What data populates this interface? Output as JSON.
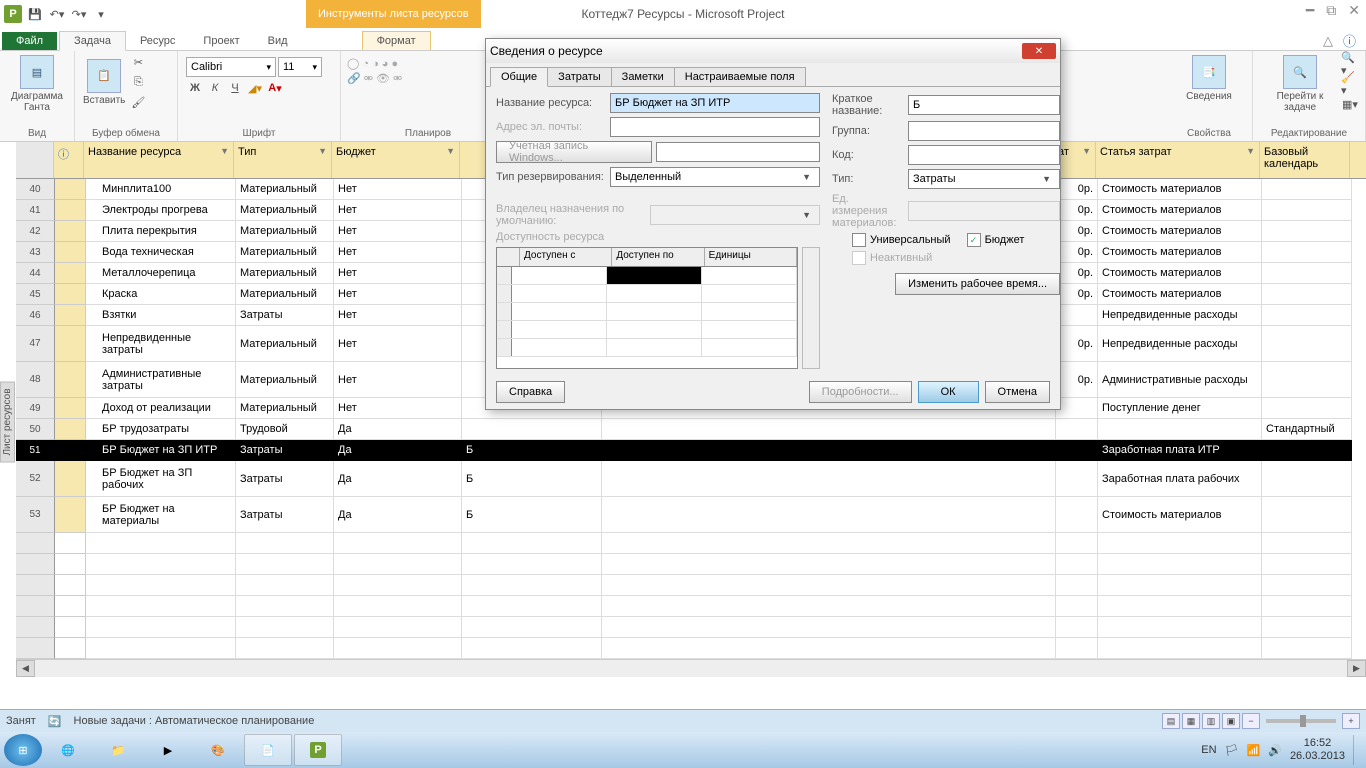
{
  "app": {
    "title": "Коттедж7 Ресурсы - Microsoft Project"
  },
  "contextTab": "Инструменты листа ресурсов",
  "tabs": {
    "file": "Файл",
    "task": "Задача",
    "resource": "Ресурс",
    "project": "Проект",
    "view": "Вид",
    "format": "Формат"
  },
  "ribbon": {
    "gantt": "Диаграмма Ганта",
    "paste": "Вставить",
    "view": "Вид",
    "clipboard": "Буфер обмена",
    "font": "Шрифт",
    "planning": "Планиров",
    "fontName": "Calibri",
    "fontSize": "11",
    "info": "Сведения",
    "gotoTask": "Перейти к задаче",
    "props": "Свойства",
    "edit": "Редактирование"
  },
  "columns": {
    "info": "",
    "name": "Название ресурса",
    "type": "Тип",
    "budget": "Бюджет",
    "costItem": "Статья затрат",
    "baseCal": "Базовый календарь"
  },
  "rows": [
    {
      "n": 40,
      "name": "Минплита100",
      "type": "Материальный",
      "budget": "Нет",
      "cost": "0р.",
      "item": "Стоимость материалов"
    },
    {
      "n": 41,
      "name": "Электроды прогрева",
      "type": "Материальный",
      "budget": "Нет",
      "cost": "0р.",
      "item": "Стоимость материалов"
    },
    {
      "n": 42,
      "name": "Плита перекрытия",
      "type": "Материальный",
      "budget": "Нет",
      "cost": "0р.",
      "item": "Стоимость материалов"
    },
    {
      "n": 43,
      "name": "Вода техническая",
      "type": "Материальный",
      "budget": "Нет",
      "cost": "0р.",
      "item": "Стоимость материалов"
    },
    {
      "n": 44,
      "name": "Металлочерепица",
      "type": "Материальный",
      "budget": "Нет",
      "cost": "0р.",
      "item": "Стоимость материалов"
    },
    {
      "n": 45,
      "name": "Краска",
      "type": "Материальный",
      "budget": "Нет",
      "cost": "0р.",
      "item": "Стоимость материалов"
    },
    {
      "n": 46,
      "name": "Взятки",
      "type": "Затраты",
      "budget": "Нет",
      "cost": "",
      "item": "Непредвиденные расходы"
    },
    {
      "n": 47,
      "name": "Непредвиденные затраты",
      "type": "Материальный",
      "budget": "Нет",
      "cost": "0р.",
      "item": "Непредвиденные расходы",
      "tall": true
    },
    {
      "n": 48,
      "name": "Административные затраты",
      "type": "Материальный",
      "budget": "Нет",
      "cost": "0р.",
      "item": "Административные расходы",
      "tall": true
    },
    {
      "n": 49,
      "name": "Доход от реализации",
      "type": "Материальный",
      "budget": "Нет",
      "cost": "",
      "item": "Поступление денег"
    },
    {
      "n": 50,
      "name": "БР трудозатраты",
      "type": "Трудовой",
      "budget": "Да",
      "short": "",
      "cost": "",
      "item": "",
      "cal": "Стандартный"
    },
    {
      "n": 51,
      "name": "БР Бюджет на ЗП ИТР",
      "type": "Затраты",
      "budget": "Да",
      "short": "Б",
      "cost": "",
      "item": "Заработная плата ИТР",
      "selected": true
    },
    {
      "n": 52,
      "name": "БР Бюджет на ЗП рабочих",
      "type": "Затраты",
      "budget": "Да",
      "short": "Б",
      "cost": "",
      "item": "Заработная плата рабочих",
      "tall": true
    },
    {
      "n": 53,
      "name": "БР Бюджет на материалы",
      "type": "Затраты",
      "budget": "Да",
      "short": "Б",
      "cost": "",
      "item": "Стоимость материалов",
      "tall": true
    }
  ],
  "sidebarLabel": "Лист ресурсов",
  "dialog": {
    "title": "Сведения о ресурсе",
    "tabs": {
      "general": "Общие",
      "costs": "Затраты",
      "notes": "Заметки",
      "custom": "Настраиваемые поля"
    },
    "labels": {
      "resName": "Название ресурса:",
      "email": "Адрес эл. почты:",
      "winAcct": "Учетная запись Windows...",
      "reserveType": "Тип резервирования:",
      "owner": "Владелец назначения по умолчанию:",
      "availHdr": "Доступность ресурса",
      "shortName": "Краткое название:",
      "group": "Группа:",
      "code": "Код:",
      "type": "Тип:",
      "matUnit": "Ед. измерения материалов:",
      "universal": "Универсальный",
      "budget": "Бюджет",
      "inactive": "Неактивный",
      "changeTime": "Изменить рабочее время...",
      "availFrom": "Доступен с",
      "availTo": "Доступен по",
      "units": "Единицы"
    },
    "values": {
      "resName": "БР Бюджет на ЗП ИТР",
      "shortName": "Б",
      "reserveType": "Выделенный",
      "type": "Затраты",
      "budgetChecked": true
    },
    "buttons": {
      "help": "Справка",
      "details": "Подробности...",
      "ok": "ОК",
      "cancel": "Отмена"
    }
  },
  "status": {
    "state": "Занят",
    "newTasks": "Новые задачи : Автоматическое планирование"
  },
  "tray": {
    "lang": "EN",
    "time": "16:52",
    "date": "26.03.2013"
  }
}
